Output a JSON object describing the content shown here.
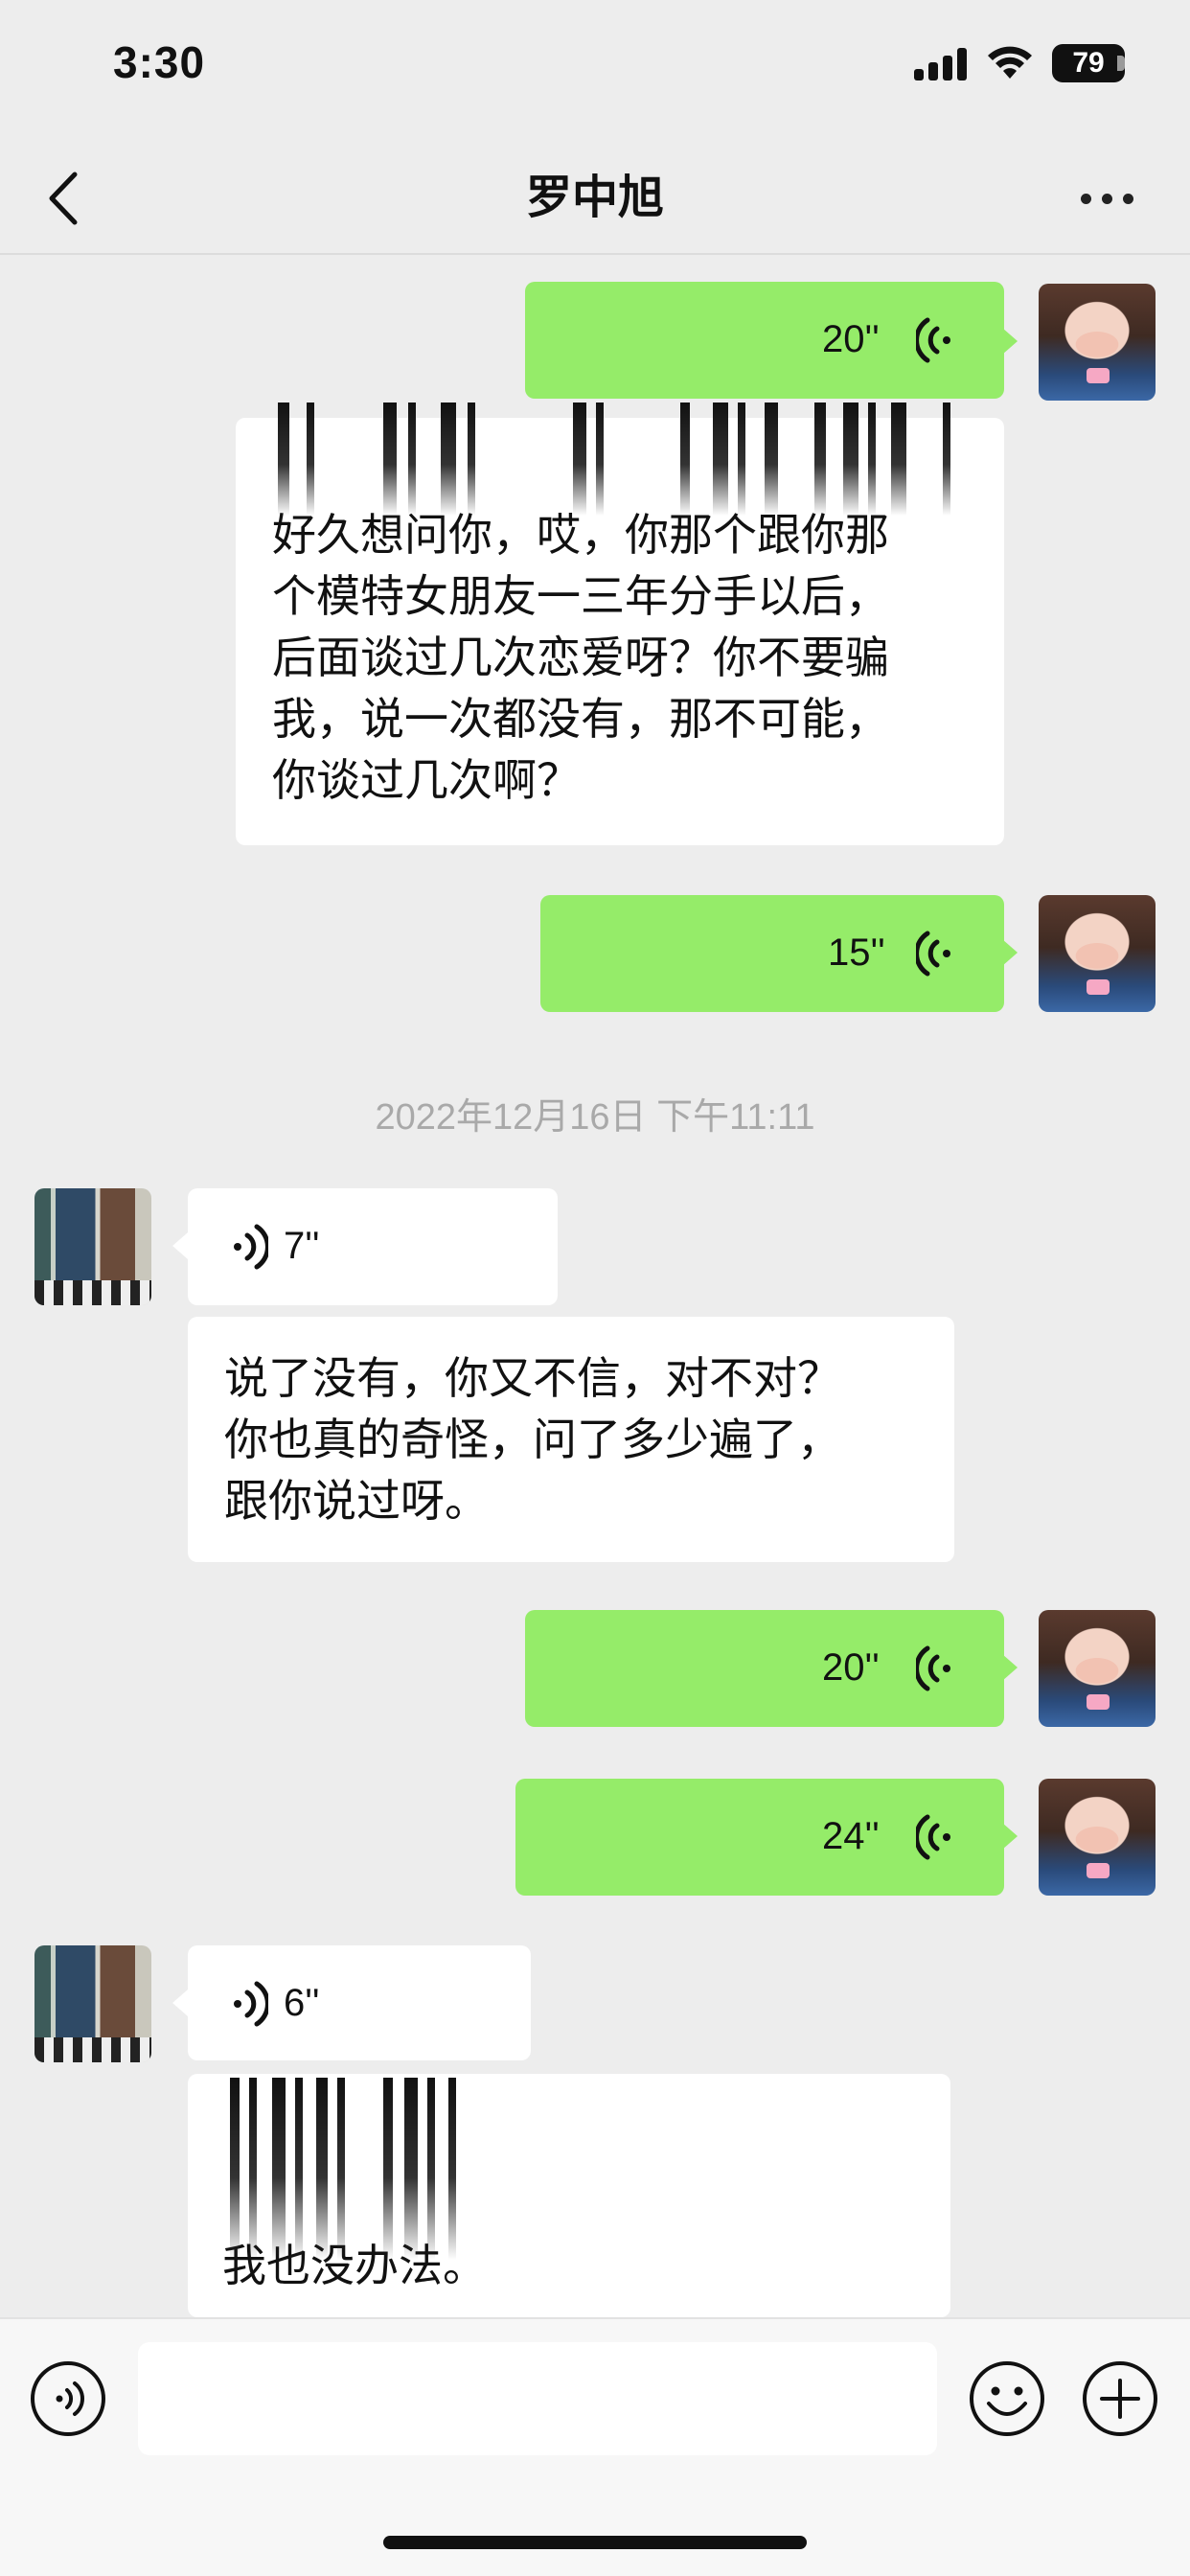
{
  "status_bar": {
    "time": "3:30",
    "battery": "79"
  },
  "nav": {
    "title": "罗中旭",
    "back_icon": "chevron-left-icon",
    "more_icon": "more-dots-icon"
  },
  "messages": [
    {
      "side": "right",
      "type": "voice",
      "duration": "20''"
    },
    {
      "side": "right",
      "type": "text",
      "lines": [
        "好久想问你，哎，你那个跟你那",
        "个模特女朋友一三年分手以后，",
        "后面谈过几次恋爱呀？你不要骗",
        "我，说一次都没有，那不可能，",
        "你谈过几次啊？"
      ]
    },
    {
      "side": "right",
      "type": "voice",
      "duration": "15''"
    },
    {
      "type": "timestamp",
      "text": "2022年12月16日 下午11:11"
    },
    {
      "side": "left",
      "type": "voice",
      "duration": "7''"
    },
    {
      "side": "left",
      "type": "text",
      "lines": [
        "说了没有，你又不信，对不对？",
        "你也真的奇怪，问了多少遍了，",
        "跟你说过呀。"
      ]
    },
    {
      "side": "right",
      "type": "voice",
      "duration": "20''"
    },
    {
      "side": "right",
      "type": "voice",
      "duration": "24''"
    },
    {
      "side": "left",
      "type": "voice",
      "duration": "6''"
    },
    {
      "side": "left",
      "type": "text",
      "lines": [
        "我也没办法。"
      ]
    }
  ],
  "input_bar": {
    "voice_icon": "voice-mode-icon",
    "emoji_icon": "emoji-icon",
    "plus_icon": "plus-icon",
    "input_value": ""
  },
  "colors": {
    "sent_bubble": "#95ec69",
    "received_bubble": "#ffffff",
    "background": "#ededed"
  }
}
